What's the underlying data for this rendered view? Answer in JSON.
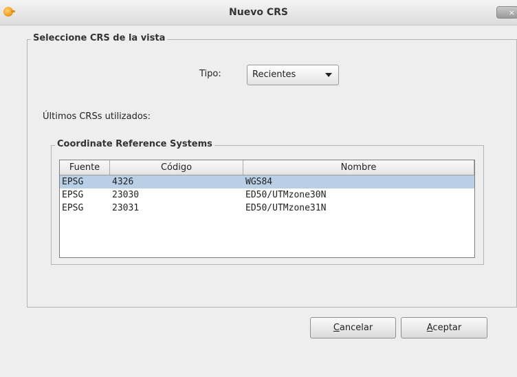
{
  "window": {
    "title": "Nuevo CRS",
    "close_label": "×"
  },
  "group": {
    "legend": "Seleccione CRS de la vista",
    "tipo_label": "Tipo:",
    "tipo_selected": "Recientes",
    "recent_label": "Últimos CRSs utilizados:"
  },
  "crs_group": {
    "legend": "Coordinate Reference Systems",
    "columns": [
      "Fuente",
      "Código",
      "Nombre"
    ],
    "rows": [
      [
        "EPSG",
        "4326",
        "WGS84"
      ],
      [
        "EPSG",
        "23030",
        "ED50/UTMzone30N"
      ],
      [
        "EPSG",
        "23031",
        "ED50/UTMzone31N"
      ]
    ],
    "selected_row": 0
  },
  "buttons": {
    "cancel_mnemonic": "C",
    "cancel_rest": "ancelar",
    "accept_mnemonic": "A",
    "accept_rest": "ceptar"
  },
  "colors": {
    "selection": "#b8cfe5",
    "background": "#eeeeee"
  }
}
